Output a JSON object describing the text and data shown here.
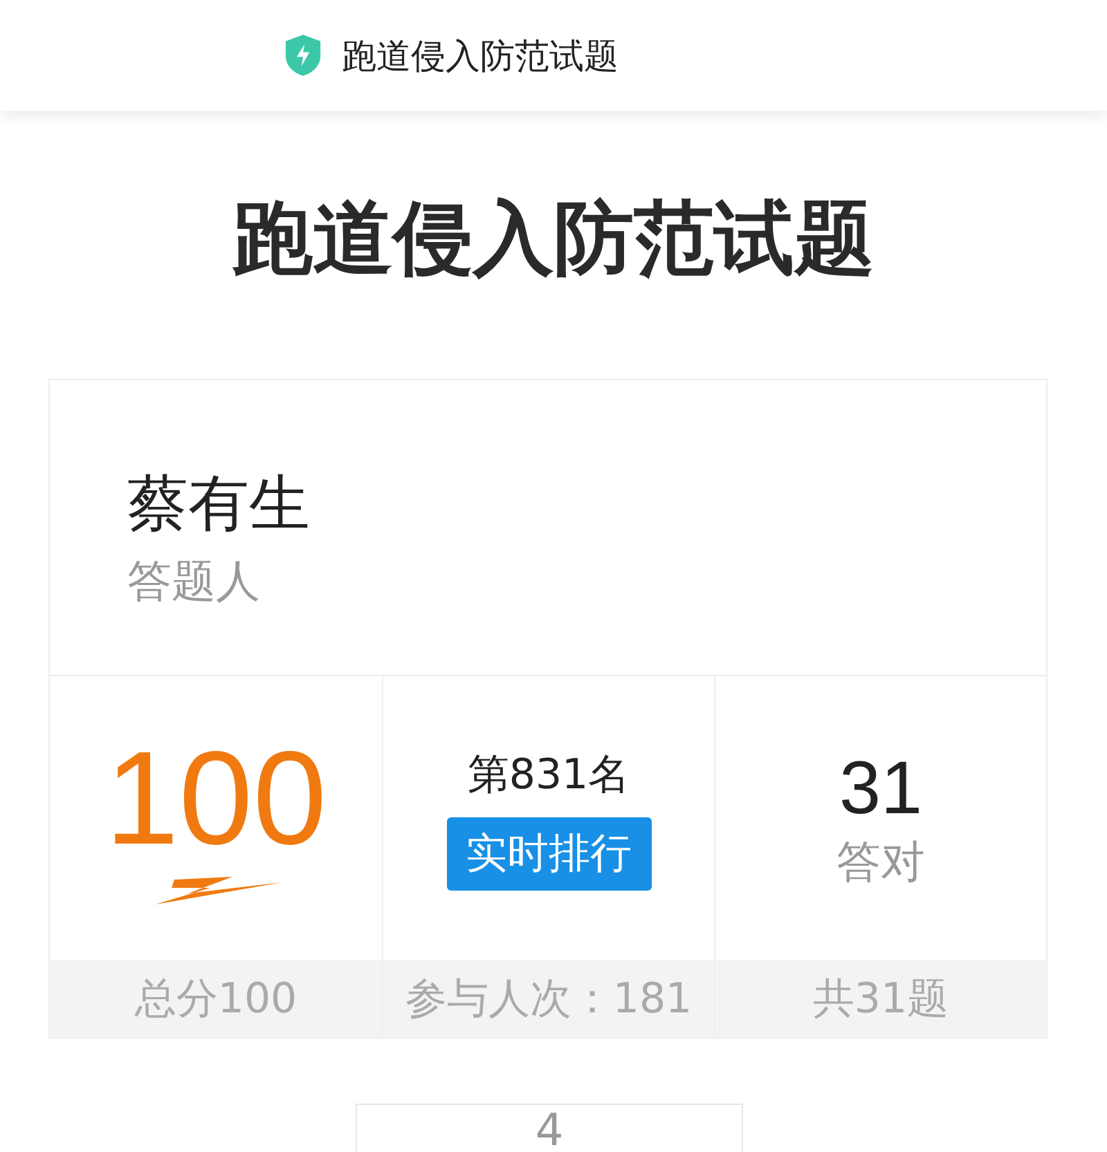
{
  "header": {
    "title": "跑道侵入防范试题"
  },
  "page_title": "跑道侵入防范试题",
  "respondent": {
    "name": "蔡有生",
    "label": "答题人"
  },
  "stats": [
    {
      "kind": "score",
      "value": "100",
      "footer": "总分100"
    },
    {
      "kind": "rank",
      "value": "第831名",
      "button": "实时排行",
      "footer": "参与人次：181"
    },
    {
      "kind": "correct",
      "value": "31",
      "caption": "答对",
      "footer": "共31题"
    }
  ],
  "next_card": {
    "value": "4"
  }
}
